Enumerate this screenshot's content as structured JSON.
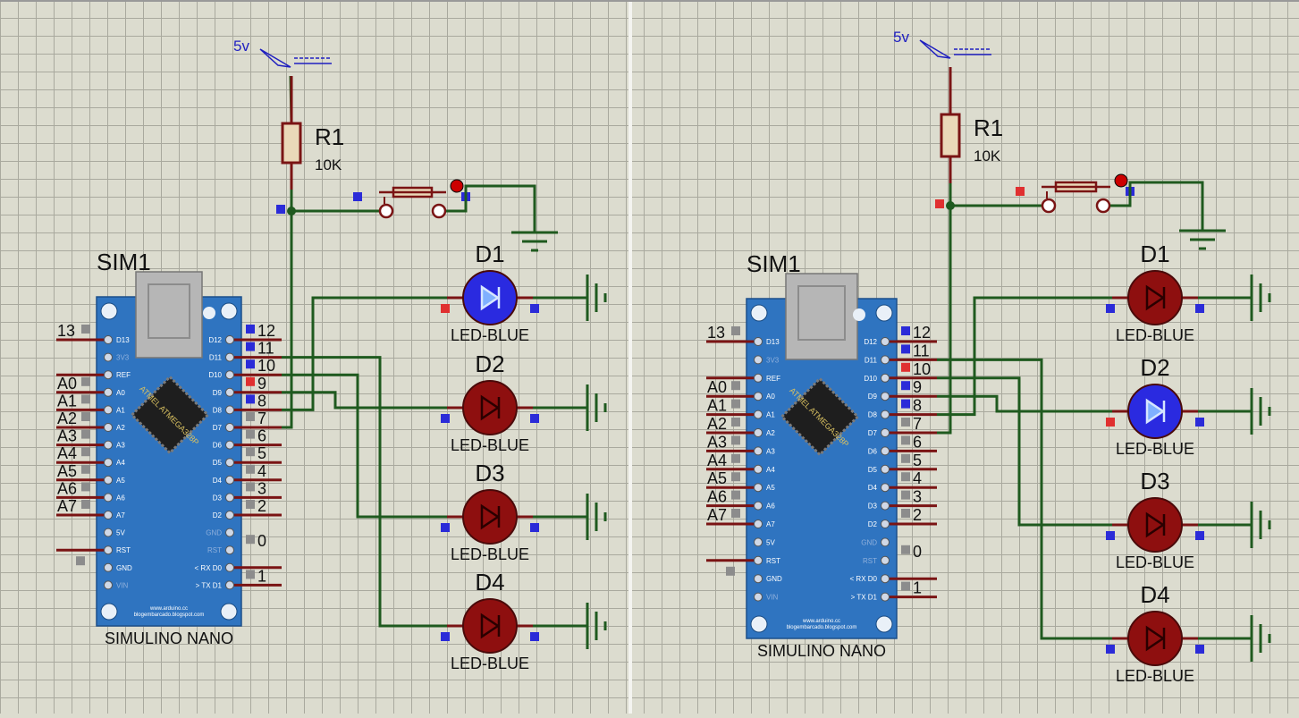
{
  "colors": {
    "background": "#dcdccf",
    "grid": "#a9a99e",
    "wire": "#1f5a1f",
    "component": "#7a1414",
    "board": "#2f74c0",
    "led_off": "#8e0f0f",
    "led_on": "#2a2ae0",
    "pin_blue": "#2b2bd8",
    "pin_red": "#e03030",
    "pin_gray": "#8c8c8c",
    "label": "#111111",
    "label_blue": "#1f1fc0"
  },
  "panels": [
    {
      "name": "left-circuit",
      "power_label": "5v",
      "resistor": {
        "ref": "R1",
        "value": "10K"
      },
      "board": {
        "ref": "SIM1",
        "name": "SIMULINO NANO",
        "chip_text": "ATMEL ATMEGA328P",
        "footer_line1": "www.arduino.cc",
        "footer_line2": "blogembarcado.blogspot.com",
        "left_pins": [
          "D13",
          "3V3",
          "REF",
          "A0",
          "A1",
          "A2",
          "A3",
          "A4",
          "A5",
          "A6",
          "A7",
          "5V",
          "RST",
          "GND",
          "VIN"
        ],
        "right_pins": [
          "D12",
          "D11",
          "D10",
          "D9",
          "D8",
          "D7",
          "D6",
          "D5",
          "D4",
          "D3",
          "D2",
          "GND",
          "RST",
          "< RX D0",
          "> TX D1"
        ],
        "left_nets": [
          "13",
          "",
          "",
          "A0",
          "A1",
          "A2",
          "A3",
          "A4",
          "A5",
          "A6",
          "A7",
          "",
          "",
          "",
          ""
        ],
        "right_nets": [
          "12",
          "11",
          "10",
          "9",
          "8",
          "7",
          "6",
          "5",
          "4",
          "3",
          "2",
          "",
          "0",
          "",
          "1"
        ]
      },
      "leds": [
        {
          "ref": "D1",
          "type": "LED-BLUE",
          "lit": true
        },
        {
          "ref": "D2",
          "type": "LED-BLUE",
          "lit": false
        },
        {
          "ref": "D3",
          "type": "LED-BLUE",
          "lit": false
        },
        {
          "ref": "D4",
          "type": "LED-BLUE",
          "lit": false
        }
      ]
    },
    {
      "name": "right-circuit",
      "power_label": "5v",
      "resistor": {
        "ref": "R1",
        "value": "10K"
      },
      "board": {
        "ref": "SIM1",
        "name": "SIMULINO NANO",
        "chip_text": "ATMEL ATMEGA328P",
        "footer_line1": "www.arduino.cc",
        "footer_line2": "blogembarcado.blogspot.com",
        "left_pins": [
          "D13",
          "3V3",
          "REF",
          "A0",
          "A1",
          "A2",
          "A3",
          "A4",
          "A5",
          "A6",
          "A7",
          "5V",
          "RST",
          "GND",
          "VIN"
        ],
        "right_pins": [
          "D12",
          "D11",
          "D10",
          "D9",
          "D8",
          "D7",
          "D6",
          "D5",
          "D4",
          "D3",
          "D2",
          "GND",
          "RST",
          "< RX D0",
          "> TX D1"
        ],
        "left_nets": [
          "13",
          "",
          "",
          "A0",
          "A1",
          "A2",
          "A3",
          "A4",
          "A5",
          "A6",
          "A7",
          "",
          "",
          "",
          ""
        ],
        "right_nets": [
          "12",
          "11",
          "10",
          "9",
          "8",
          "7",
          "6",
          "5",
          "4",
          "3",
          "2",
          "",
          "0",
          "",
          "1"
        ]
      },
      "leds": [
        {
          "ref": "D1",
          "type": "LED-BLUE",
          "lit": false
        },
        {
          "ref": "D2",
          "type": "LED-BLUE",
          "lit": true
        },
        {
          "ref": "D3",
          "type": "LED-BLUE",
          "lit": false
        },
        {
          "ref": "D4",
          "type": "LED-BLUE",
          "lit": false
        }
      ]
    }
  ]
}
